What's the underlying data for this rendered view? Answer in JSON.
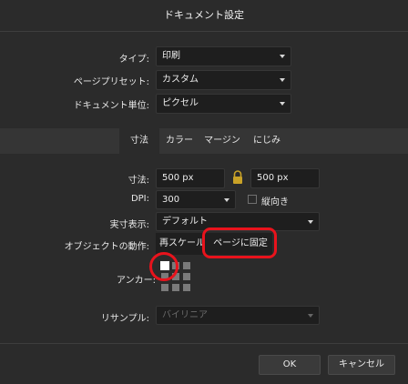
{
  "dialog": {
    "title": "ドキュメント設定"
  },
  "document": {
    "type_label": "タイプ:",
    "type_value": "印刷",
    "preset_label": "ページプリセット:",
    "preset_value": "カスタム",
    "units_label": "ドキュメント単位:",
    "units_value": "ピクセル"
  },
  "tabs": [
    {
      "label": "寸法",
      "active": true
    },
    {
      "label": "カラー",
      "active": false
    },
    {
      "label": "マージン",
      "active": false
    },
    {
      "label": "にじみ",
      "active": false
    }
  ],
  "dimensions": {
    "size_label": "寸法:",
    "width_value": "500 px",
    "height_value": "500 px",
    "dpi_label": "DPI:",
    "dpi_value": "300",
    "landscape_label": "縦向き",
    "landscape_checked": false,
    "actual_size_label": "実寸表示:",
    "actual_size_value": "デフォルト",
    "object_action_label": "オブジェクトの動作:",
    "rescale_label": "再スケール",
    "anchor_to_page_label": "ページに固定",
    "anchor_label": "アンカー:",
    "resample_label": "リサンプル:",
    "resample_value": "バイリニア"
  },
  "footer": {
    "ok_label": "OK",
    "cancel_label": "キャンセル"
  },
  "colors": {
    "background": "#2b2b2b",
    "field": "#1e1e1e",
    "highlight": "#e8131c",
    "lock": "#c9a227"
  }
}
